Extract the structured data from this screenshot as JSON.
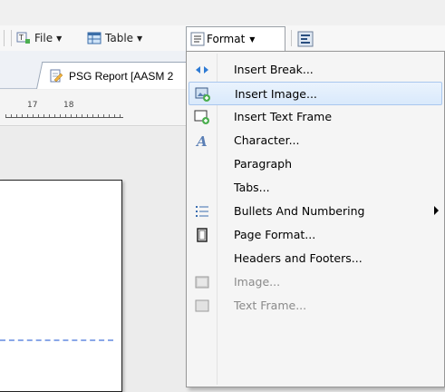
{
  "toolbar": {
    "file_label": "File",
    "table_label": "Table",
    "format_label": "Format"
  },
  "tabs": {
    "document_tab_label": "PSG Report [AASM 2"
  },
  "ruler": {
    "numbers": [
      "17",
      "18"
    ]
  },
  "format_menu": {
    "items": [
      {
        "label": "Insert Break...",
        "icon": "break-arrows-icon",
        "enabled": true
      },
      {
        "label": "Insert Image...",
        "icon": "insert-image-icon",
        "enabled": true,
        "highlighted": true
      },
      {
        "label": "Insert Text Frame",
        "icon": "insert-text-frame-icon",
        "enabled": true
      },
      {
        "label": "Character...",
        "icon": "character-icon",
        "enabled": true
      },
      {
        "label": "Paragraph",
        "icon": "",
        "enabled": true
      },
      {
        "label": "Tabs...",
        "icon": "",
        "enabled": true
      },
      {
        "label": "Bullets And Numbering",
        "icon": "bullets-icon",
        "enabled": true,
        "has_submenu": true
      },
      {
        "label": "Page Format...",
        "icon": "page-format-icon",
        "enabled": true
      },
      {
        "label": "Headers and Footers...",
        "icon": "",
        "enabled": true
      },
      {
        "label": "Image...",
        "icon": "image-disabled-icon",
        "enabled": false
      },
      {
        "label": "Text Frame...",
        "icon": "text-frame-disabled-icon",
        "enabled": false
      }
    ]
  },
  "colors": {
    "menu_hover_border": "#a9c7ee",
    "menu_hover_fill": "#d9e9fb",
    "dash_line": "#8aa7e8"
  }
}
